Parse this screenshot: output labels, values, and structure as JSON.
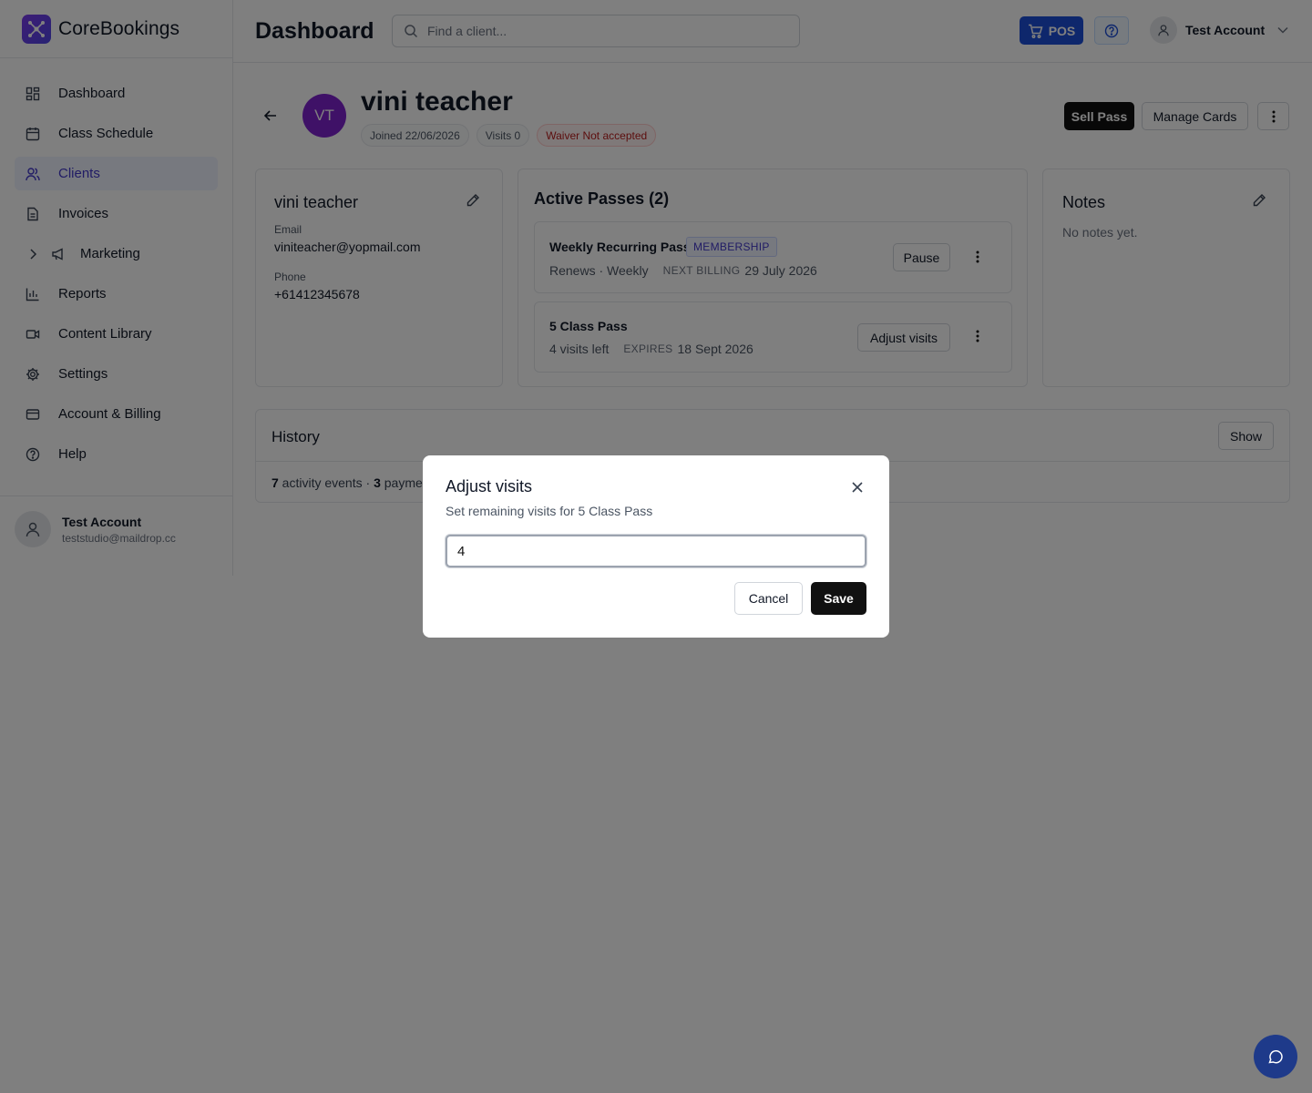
{
  "brand": {
    "name": "CoreBookings"
  },
  "sidebar": {
    "items": [
      {
        "label": "Dashboard",
        "icon": "dashboard-icon"
      },
      {
        "label": "Class Schedule",
        "icon": "calendar-icon"
      },
      {
        "label": "Clients",
        "icon": "users-icon",
        "active": true
      },
      {
        "label": "Invoices",
        "icon": "file-text-icon"
      },
      {
        "label": "Marketing",
        "icon": "megaphone-icon",
        "expandable": true
      },
      {
        "label": "Reports",
        "icon": "bar-chart-icon"
      },
      {
        "label": "Content Library",
        "icon": "video-icon"
      },
      {
        "label": "Settings",
        "icon": "gear-icon"
      },
      {
        "label": "Account & Billing",
        "icon": "credit-card-icon"
      },
      {
        "label": "Help",
        "icon": "help-circle-icon"
      }
    ],
    "footer": {
      "name": "Test Account",
      "email": "teststudio@maildrop.cc"
    }
  },
  "header": {
    "title": "Dashboard",
    "search_placeholder": "Find a client...",
    "pos_label": "POS",
    "account_name": "Test Account"
  },
  "client": {
    "initials": "VT",
    "name": "vini teacher",
    "joined": "Joined 22/06/2026",
    "visits": "Visits 0",
    "waiver": "Waiver Not accepted",
    "actions": {
      "sell": "Sell Pass",
      "manage": "Manage Cards"
    }
  },
  "contact": {
    "name": "vini teacher",
    "email_label": "Email",
    "email": "viniteacher@yopmail.com",
    "phone_label": "Phone",
    "phone": "+61412345678"
  },
  "passes": {
    "title": "Active Passes (2)",
    "items": [
      {
        "name": "Weekly Recurring Pass",
        "badge": "MEMBERSHIP",
        "sub": "Renews · Weekly",
        "key": "NEXT BILLING",
        "value": "29 July 2026",
        "action": "Pause"
      },
      {
        "name": "5 Class Pass",
        "sub": "4 visits left",
        "key": "EXPIRES",
        "value": "18 Sept 2026",
        "action": "Adjust visits"
      }
    ]
  },
  "notes": {
    "title": "Notes",
    "empty": "No notes yet."
  },
  "history": {
    "title": "History",
    "show": "Show",
    "activity_count": "7",
    "activity_text": " activity events · ",
    "payment_count": "3",
    "payment_text": " paymen"
  },
  "modal": {
    "title": "Adjust visits",
    "subtitle": "Set remaining visits for 5 Class Pass",
    "value": "4",
    "cancel": "Cancel",
    "save": "Save"
  },
  "colors": {
    "accent": "#1d4ed8",
    "brand_purple": "#7e22ce",
    "primary_dark": "#111111",
    "waiver_red": "#b91c1c"
  }
}
